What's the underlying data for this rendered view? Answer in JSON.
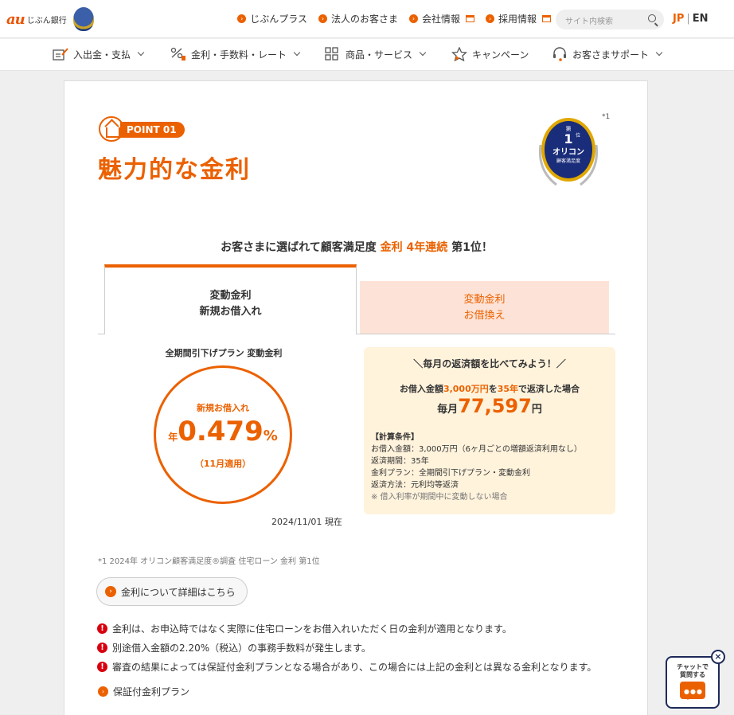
{
  "header": {
    "logo_au": "au",
    "logo_name": "じぶん銀行",
    "links": [
      {
        "label": "じぶんプラス",
        "external": false
      },
      {
        "label": "法人のお客さま",
        "external": false
      },
      {
        "label": "会社情報",
        "external": true
      },
      {
        "label": "採用情報",
        "external": true
      }
    ],
    "search_placeholder": "サイト内検索",
    "lang_jp": "JP",
    "lang_sep": "|",
    "lang_en": "EN"
  },
  "nav": {
    "items": [
      {
        "label": "入出金・支払"
      },
      {
        "label": "金利・手数料・レート"
      },
      {
        "label": "商品・サービス"
      },
      {
        "label": "キャンペーン"
      },
      {
        "label": "お客さまサポート"
      }
    ]
  },
  "section": {
    "point_label": "POINT 01",
    "title": "魅力的な金利",
    "badge": {
      "rank_top": "第",
      "rank": "1",
      "rank_suffix": "位",
      "name": "オリコン",
      "sub": "顧客満足度"
    },
    "badge_note": "*1",
    "subhead_pre": "お客さまに選ばれて顧客満足度 ",
    "subhead_hl": "金利 4年連続",
    "subhead_post": " 第1位！"
  },
  "tabs": [
    {
      "line1": "変動金利",
      "line2": "新規お借入れ"
    },
    {
      "line1": "変動金利",
      "line2": "お借換え"
    }
  ],
  "rate": {
    "plan_label": "全期間引下げプラン 変動金利",
    "top_label": "新規お借入れ",
    "prefix": "年",
    "value": "0.479",
    "percent": "%",
    "applied": "（11月適用）",
    "as_of": "2024/11/01 現在"
  },
  "compare": {
    "heading": "＼毎月の返済額を比べてみよう！／",
    "line_pre": "お借入金額",
    "line_amount": "3,000万円",
    "line_mid": "を",
    "line_years": "35年",
    "line_post": "で返済した場合",
    "monthly_label": "毎月",
    "monthly_amount": "77,597",
    "monthly_unit": "円",
    "cond_title": "【計算条件】",
    "cond_lines": [
      "お借入金額：3,000万円（6ヶ月ごとの増額返済利用なし）",
      "返済期間：35年",
      "金利プラン：全期間引下げプラン・変動金利",
      "返済方法：元利均等返済"
    ],
    "cond_note": "※ 借入利率が期間中に変動しない場合"
  },
  "footer": {
    "footnote": "*1  2024年 オリコン顧客満足度®調査 住宅ローン 金利 第1位",
    "detail_button": "金利について詳細はこちら",
    "warnings": [
      "金利は、お申込時ではなく実際に住宅ローンをお借入れいただく日の金利が適用となります。",
      "別途借入金額の2.20%（税込）の事務手数料が発生します。",
      "審査の結果によっては保証付金利プランとなる場合があり、この場合には上記の金利とは異なる金利となります。"
    ],
    "link_label": "保証付金利プラン"
  },
  "chat": {
    "line1": "チャットで",
    "line2": "質問する",
    "close": "×"
  },
  "colors": {
    "accent": "#eb6100",
    "tab_inactive_bg": "#fde3d7",
    "compare_bg": "#fff3dc",
    "warning": "#d8000f",
    "chat_border": "#1d2a5a"
  }
}
